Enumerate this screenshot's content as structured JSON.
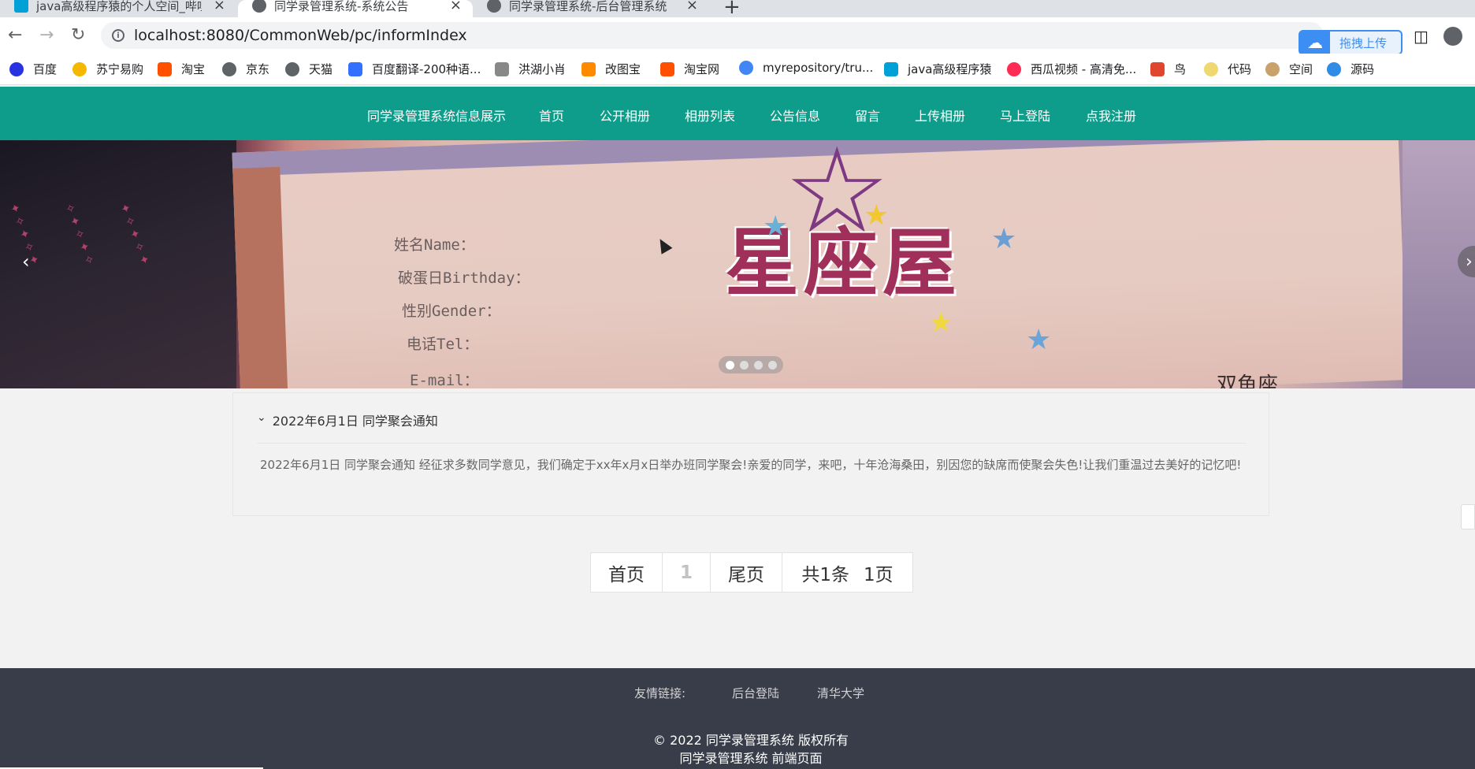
{
  "browser": {
    "tabs": [
      {
        "title": "java高级程序猿的个人空间_哔哩",
        "icon_color": "#00a1d6",
        "active": false
      },
      {
        "title": "同学录管理系统-系统公告",
        "icon_color": "#5f6368",
        "active": true
      },
      {
        "title": "同学录管理系统-后台管理系统",
        "icon_color": "#5f6368",
        "active": false
      }
    ],
    "tab_close_glyph": "×",
    "new_tab_glyph": "+",
    "url": "localhost:8080/CommonWeb/pc/informIndex",
    "upload_widget_label": "拖拽上传",
    "bookmarks": [
      {
        "label": "百度",
        "icon_color": "#2932e1"
      },
      {
        "label": "苏宁易购",
        "icon_color": "#f5b800"
      },
      {
        "label": "淘宝",
        "icon_color": "#ff5000"
      },
      {
        "label": "京东",
        "icon_color": "#5f6368"
      },
      {
        "label": "天猫",
        "icon_color": "#5f6368"
      },
      {
        "label": "百度翻译-200种语...",
        "icon_color": "#3470ff"
      },
      {
        "label": "洪湖小肖",
        "icon_color": "#888888"
      },
      {
        "label": "改图宝",
        "icon_color": "#ff8a00"
      },
      {
        "label": "淘宝网",
        "icon_color": "#ff5000"
      },
      {
        "label": "myrepository/tru...",
        "icon_color": "#4285f4"
      },
      {
        "label": "java高级程序猿",
        "icon_color": "#00a1d6"
      },
      {
        "label": "西瓜视频 - 高清免...",
        "icon_color": "#fe2c55"
      },
      {
        "label": "鸟",
        "icon_color": "#e0452f"
      },
      {
        "label": "代码",
        "icon_color": "#f0d870"
      },
      {
        "label": "空间",
        "icon_color": "#c9a26a"
      },
      {
        "label": "源码",
        "icon_color": "#2e8be6"
      }
    ]
  },
  "site": {
    "nav": [
      "同学录管理系统信息展示",
      "首页",
      "公开相册",
      "相册列表",
      "公告信息",
      "留言",
      "上传相册",
      "马上登陆",
      "点我注册"
    ],
    "nav_color": "#0d9d8a",
    "banner": {
      "fields": [
        "姓名Name：",
        "破蛋日Birthday：",
        "性别Gender：",
        "电话Tel：",
        "E-mail："
      ],
      "title": "星座屋",
      "corner_text": "双鱼座",
      "dots": 4,
      "active_dot": 0,
      "prev_glyph": "‹",
      "next_glyph": "›"
    },
    "notice": {
      "title": "2022年6月1日 同学聚会通知",
      "content": "2022年6月1日 同学聚会通知 经征求多数同学意见，我们确定于xx年x月x日举办班同学聚会!亲爱的同学，来吧，十年沧海桑田，别因您的缺席而使聚会失色!让我们重温过去美好的记忆吧!"
    },
    "pager": {
      "first": "首页",
      "current": "1",
      "last": "尾页",
      "total": "共1条",
      "pages": "1页"
    },
    "footer": {
      "friend_label": "友情链接:",
      "links": [
        "后台登陆",
        "清华大学"
      ],
      "copyright": "© 2022 同学录管理系统 版权所有",
      "subtitle": "同学录管理系统 前端页面"
    }
  }
}
